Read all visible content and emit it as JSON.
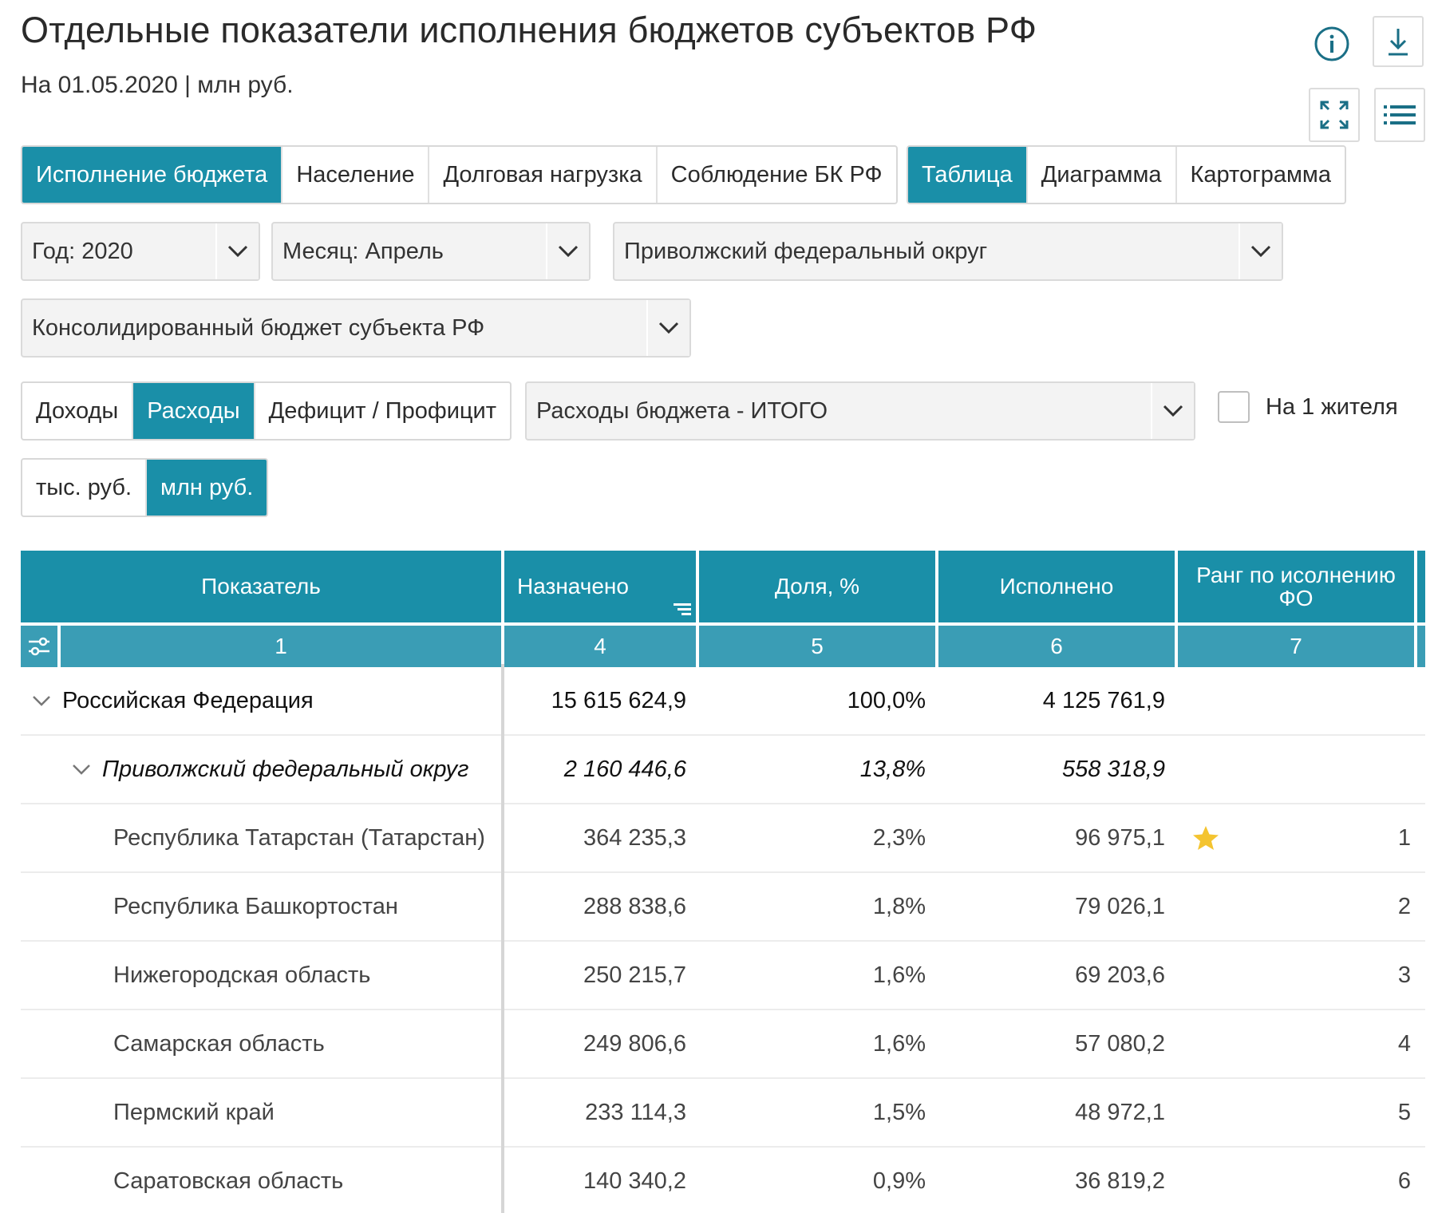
{
  "header": {
    "title": "Отдельные показатели исполнения бюджетов субъектов РФ",
    "subtitle": "На 01.05.2020 | млн руб."
  },
  "icons": {
    "info": "info-icon",
    "download": "download-icon",
    "fullscreen": "fullscreen-icon",
    "list": "list-icon"
  },
  "view_tabs": [
    {
      "label": "Исполнение бюджета",
      "active": true
    },
    {
      "label": "Население",
      "active": false
    },
    {
      "label": "Долговая нагрузка",
      "active": false
    },
    {
      "label": "Соблюдение БК РФ",
      "active": false
    }
  ],
  "display_tabs": [
    {
      "label": "Таблица",
      "active": true
    },
    {
      "label": "Диаграмма",
      "active": false
    },
    {
      "label": "Картограмма",
      "active": false
    }
  ],
  "filters": {
    "year": "Год: 2020",
    "month": "Месяц: Апрель",
    "region": "Приволжский федеральный округ",
    "budget": "Консолидированный бюджет субъекта РФ",
    "indicator": "Расходы бюджета - ИТОГО"
  },
  "type_tabs": [
    {
      "label": "Доходы",
      "active": false
    },
    {
      "label": "Расходы",
      "active": true
    },
    {
      "label": "Дефицит / Профицит",
      "active": false
    }
  ],
  "per_capita": {
    "label": "На 1 жителя",
    "checked": false
  },
  "unit_tabs": [
    {
      "label": "тыс. руб.",
      "active": false
    },
    {
      "label": "млн руб.",
      "active": true
    }
  ],
  "table": {
    "columns": [
      {
        "title": "Показатель",
        "index": "1"
      },
      {
        "title": "Назначено",
        "index": "4"
      },
      {
        "title": "Доля, %",
        "index": "5"
      },
      {
        "title": "Исполнено",
        "index": "6"
      },
      {
        "title": "Ранг по исолнению ФО",
        "index": "7"
      }
    ],
    "rows": [
      {
        "name": "Российская Федерация",
        "assigned": "15 615 624,9",
        "share": "100,0%",
        "executed": "4 125 761,9",
        "rank": "",
        "level": 0,
        "expanded": true,
        "star": false
      },
      {
        "name": "Приволжский федеральный округ",
        "assigned": "2 160 446,6",
        "share": "13,8%",
        "executed": "558 318,9",
        "rank": "",
        "level": 1,
        "expanded": true,
        "star": false
      },
      {
        "name": "Республика Татарстан (Татарстан)",
        "assigned": "364 235,3",
        "share": "2,3%",
        "executed": "96 975,1",
        "rank": "1",
        "level": 2,
        "star": true
      },
      {
        "name": "Республика Башкортостан",
        "assigned": "288 838,6",
        "share": "1,8%",
        "executed": "79 026,1",
        "rank": "2",
        "level": 2,
        "star": false
      },
      {
        "name": "Нижегородская область",
        "assigned": "250 215,7",
        "share": "1,6%",
        "executed": "69 203,6",
        "rank": "3",
        "level": 2,
        "star": false
      },
      {
        "name": "Самарская область",
        "assigned": "249 806,6",
        "share": "1,6%",
        "executed": "57 080,2",
        "rank": "4",
        "level": 2,
        "star": false
      },
      {
        "name": "Пермский край",
        "assigned": "233 114,3",
        "share": "1,5%",
        "executed": "48 972,1",
        "rank": "5",
        "level": 2,
        "star": false
      },
      {
        "name": "Саратовская область",
        "assigned": "140 340,2",
        "share": "0,9%",
        "executed": "36 819,2",
        "rank": "6",
        "level": 2,
        "star": false
      }
    ]
  },
  "colors": {
    "accent": "#1a8fa8",
    "header_secondary": "#3a9db5",
    "star": "#f4c430"
  }
}
